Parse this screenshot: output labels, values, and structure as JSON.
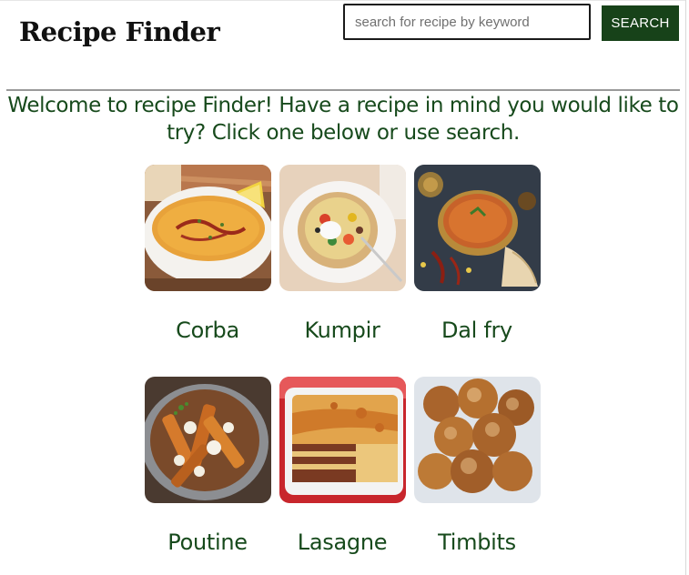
{
  "header": {
    "title": "Recipe Finder",
    "search_placeholder": "search for recipe by keyword",
    "search_value": "",
    "search_button_label": "SEARCH"
  },
  "welcome": {
    "text": "Welcome to recipe Finder! Have a recipe in mind you would like to try? Click one below or use search."
  },
  "recipes": [
    {
      "name": "Corba",
      "image": "lentil-soup-photo"
    },
    {
      "name": "Kumpir",
      "image": "stuffed-baked-potato-photo"
    },
    {
      "name": "Dal fry",
      "image": "dal-curry-photo"
    },
    {
      "name": "Poutine",
      "image": "poutine-photo"
    },
    {
      "name": "Lasagne",
      "image": "lasagne-photo"
    },
    {
      "name": "Timbits",
      "image": "donut-holes-photo"
    }
  ],
  "colors": {
    "accent_green": "#174219",
    "text_green": "#174a1c"
  }
}
